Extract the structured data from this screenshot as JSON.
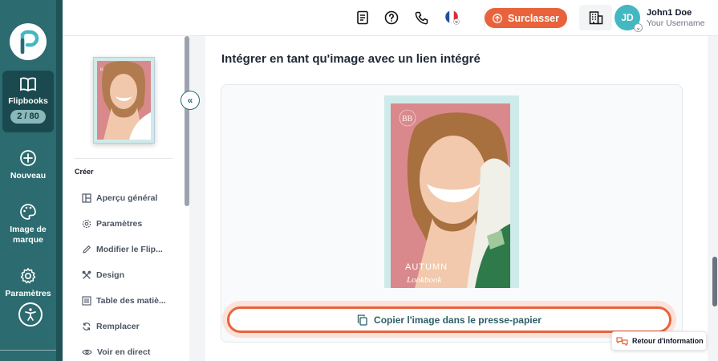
{
  "sidebar": {
    "logo_icon": "publuu-logo-icon",
    "items": [
      {
        "label": "Flipbooks",
        "count": "2 / 80",
        "icon": "open-book-icon",
        "active": true
      },
      {
        "label": "Nouveau",
        "icon": "plus-circle-icon"
      },
      {
        "label": "Image de marque",
        "icon": "palette-icon"
      },
      {
        "label": "Paramètres",
        "icon": "gear-icon"
      }
    ],
    "accessibility_icon": "accessibility-icon"
  },
  "header": {
    "icons": [
      "document-icon",
      "help-icon",
      "phone-icon",
      "french-flag-icon"
    ],
    "upgrade_label": "Surclasser",
    "org_icon": "building-icon",
    "avatar_initials": "JD",
    "user_name": "John1 Doe",
    "user_subtitle": "Your Username"
  },
  "panel": {
    "section_label": "Créer",
    "collapse_icon": "double-chevron-left-icon",
    "menu": [
      {
        "label": "Aperçu général",
        "icon": "layout-icon"
      },
      {
        "label": "Paramètres",
        "icon": "gear-icon"
      },
      {
        "label": "Modifier le Flip...",
        "icon": "pencil-icon"
      },
      {
        "label": "Design",
        "icon": "tools-icon"
      },
      {
        "label": "Table des matiè...",
        "icon": "table-icon"
      },
      {
        "label": "Remplacer",
        "icon": "refresh-icon"
      },
      {
        "label": "Voir en direct",
        "icon": "eye-icon"
      }
    ]
  },
  "main": {
    "title": "Intégrer en tant qu'image avec un lien intégré",
    "cover": {
      "headline": "AUTUMN",
      "script": "Lookbook"
    },
    "copy_button_label": "Copier l'image dans le presse-papier",
    "copy_icon": "copy-icon"
  },
  "toast": {
    "label": "Retour d'information",
    "icon": "feedback-icon"
  },
  "colors": {
    "rail": "#2c6b70",
    "accent": "#e8633c",
    "avatar": "#43b7c2"
  }
}
